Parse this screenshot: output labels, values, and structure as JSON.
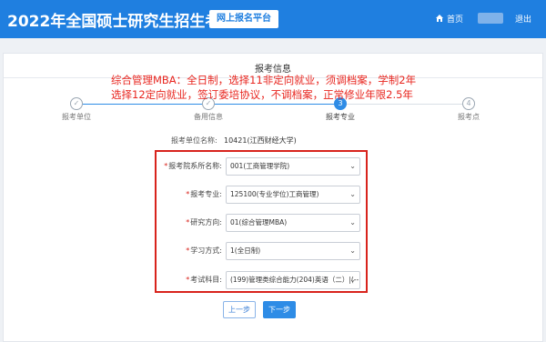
{
  "header": {
    "brand": "2022年全国硕士研究生招生考试",
    "platform": "网上报名平台",
    "home": "首页",
    "logout": "退出"
  },
  "card": {
    "title": "报考信息"
  },
  "annotation": {
    "line1": "综合管理MBA：全日制，选择11非定向就业，须调档案，学制2年",
    "line2": "选择12定向就业，签订委培协议，不调档案，正常修业年限2.5年"
  },
  "steps": [
    {
      "number": "✓",
      "label": "报考单位"
    },
    {
      "number": "✓",
      "label": "备用信息"
    },
    {
      "number": "3",
      "label": "报考专业"
    },
    {
      "number": "4",
      "label": "报考点"
    }
  ],
  "form": {
    "school_label": "报考单位名称:",
    "school_value": "10421(江西财经大学)",
    "fields": [
      {
        "label": "报考院系所名称:",
        "value": "001(工商管理学院)"
      },
      {
        "label": "报考专业:",
        "value": "125100(专业学位)工商管理)"
      },
      {
        "label": "研究方向:",
        "value": "01(综合管理MBA)"
      },
      {
        "label": "学习方式:",
        "value": "1(全日制)"
      },
      {
        "label": "考试科目:",
        "value": "(199)管理类综合能力(204)英语（二）|(--"
      }
    ],
    "required_mark": "*",
    "chevron": "⌄"
  },
  "buttons": {
    "prev": "上一步",
    "next": "下一步"
  },
  "colors": {
    "header": "#1f7fe0",
    "accent": "#2e8ce6",
    "annotation": "#e8261f"
  }
}
